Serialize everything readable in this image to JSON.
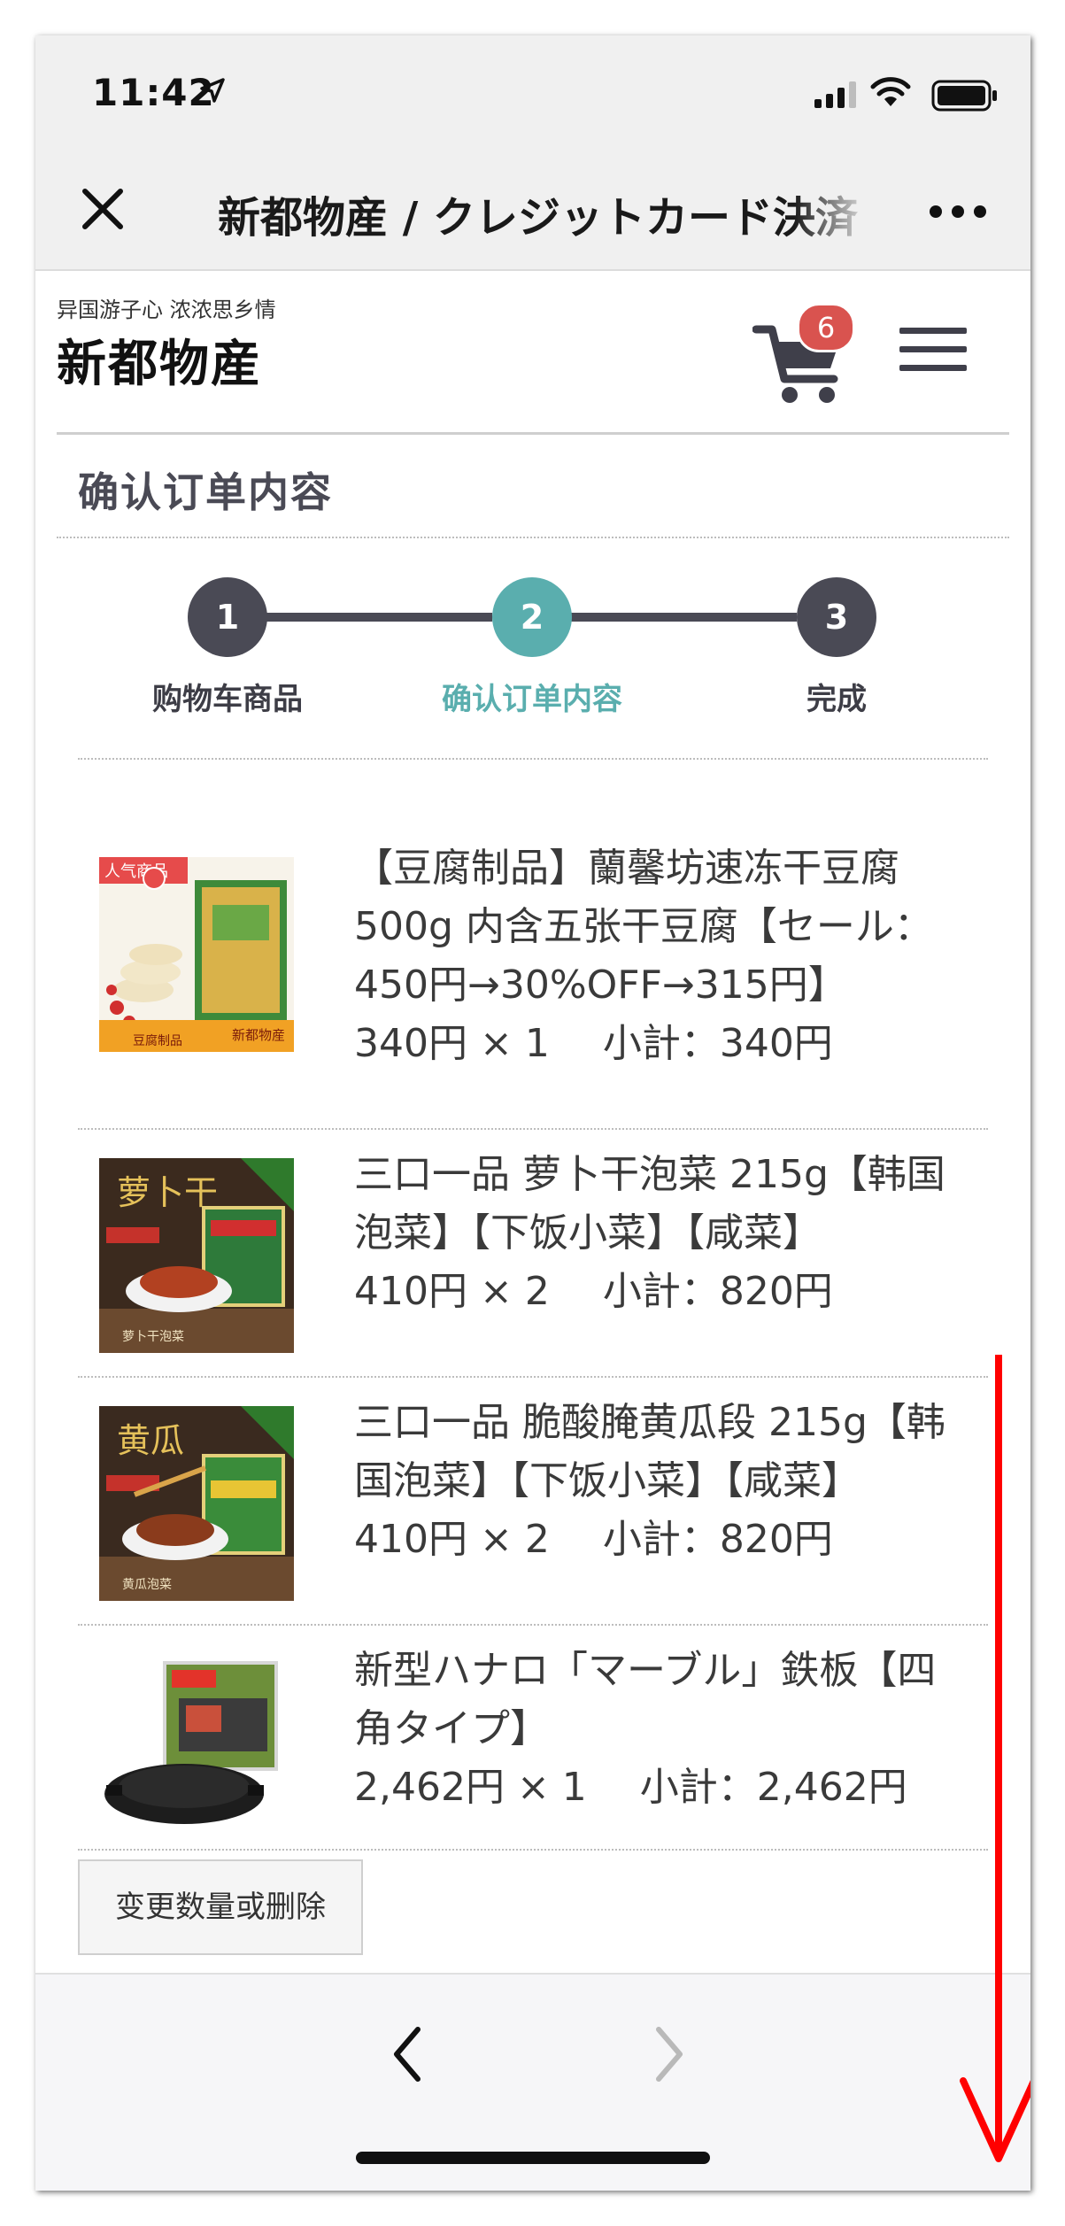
{
  "status_bar": {
    "time": "11:42"
  },
  "webview": {
    "title": "新都物産 / クレジットカード決済"
  },
  "site": {
    "tagline": "异国游子心 浓浓思乡情",
    "name": "新都物産",
    "cart_count": "6"
  },
  "page": {
    "title": "确认订单内容"
  },
  "steps": [
    {
      "number": "1",
      "label": "购物车商品",
      "state": "done"
    },
    {
      "number": "2",
      "label": "确认订单内容",
      "state": "active"
    },
    {
      "number": "3",
      "label": "完成",
      "state": "pending"
    }
  ],
  "items": [
    {
      "name": "【豆腐制品】蘭馨坊速冻干豆腐500g 内含五张干豆腐【セール：450円→30%OFF→315円】",
      "lines": [
        "【豆腐制品】蘭馨坊速冻干豆腐",
        "500g 内含五张干豆腐【セール：",
        "450円→30%OFF→315円】"
      ],
      "price": "340円 × 1",
      "subtotal": "小計：340円",
      "image_label": "人气商品",
      "image_brand": "新都物産",
      "image_caption": "豆腐制品"
    },
    {
      "name": "三口一品 萝卜干泡菜 215g【韩国泡菜】【下饭小菜】【咸菜】",
      "lines": [
        "三口一品 萝卜干泡菜 215g【韩国",
        "泡菜】【下饭小菜】【咸菜】"
      ],
      "price": "410円 × 2",
      "subtotal": "小計：820円",
      "image_label": "萝卜干",
      "image_caption": "萝卜干泡菜"
    },
    {
      "name": "三口一品 脆酸腌黄瓜段 215g【韩国泡菜】【下饭小菜】【咸菜】",
      "lines": [
        "三口一品 脆酸腌黄瓜段 215g【韩",
        "国泡菜】【下饭小菜】【咸菜】"
      ],
      "price": "410円 × 2",
      "subtotal": "小計：820円",
      "image_label": "黄瓜",
      "image_caption": "黄瓜泡菜"
    },
    {
      "name": "新型ハナロ「マーブル」鉄板【四角タイプ】",
      "lines": [
        "新型ハナロ「マーブル」鉄板【四",
        "角タイプ】"
      ],
      "price": "2,462円 × 1",
      "subtotal": "小計：2,462円"
    }
  ],
  "actions": {
    "change_label": "变更数量或删除"
  },
  "colors": {
    "step_done": "#4a4a55",
    "step_active": "#5aaeae",
    "badge": "#d9534f",
    "annotation_arrow": "#ff0000"
  }
}
